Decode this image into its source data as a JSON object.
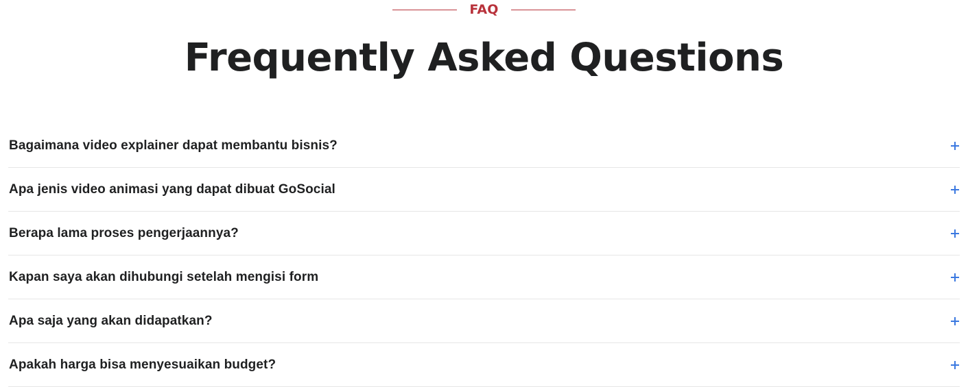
{
  "section": {
    "eyebrow": "FAQ",
    "title": "Frequently Asked Questions"
  },
  "faq": {
    "items": [
      {
        "question": "Bagaimana video explainer dapat membantu bisnis?",
        "icon": "plus-icon",
        "expanded": false
      },
      {
        "question": "Apa jenis video animasi yang dapat dibuat GoSocial",
        "icon": "plus-icon",
        "expanded": false
      },
      {
        "question": "Berapa lama proses pengerjaannya?",
        "icon": "plus-icon",
        "expanded": false
      },
      {
        "question": "Kapan saya akan dihubungi setelah mengisi form",
        "icon": "plus-icon",
        "expanded": false
      },
      {
        "question": "Apa saja yang akan didapatkan?",
        "icon": "plus-icon",
        "expanded": false
      },
      {
        "question": "Apakah harga bisa menyesuaikan budget?",
        "icon": "plus-icon",
        "expanded": false
      }
    ]
  },
  "colors": {
    "accent": "#b8323b",
    "icon": "#3a78e0",
    "text": "#1f2021",
    "divider": "#e6e6e6"
  }
}
